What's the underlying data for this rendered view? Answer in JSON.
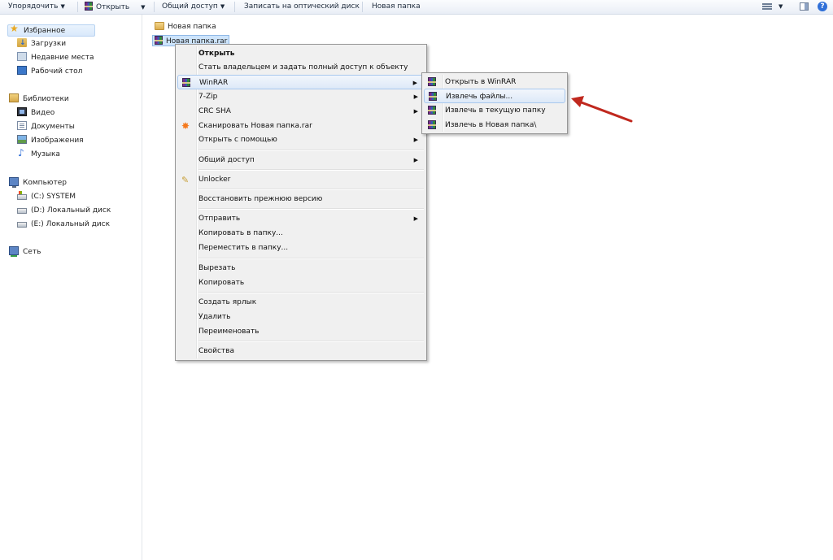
{
  "toolbar": {
    "organize": "Упорядочить",
    "open": "Открыть",
    "share": "Общий доступ",
    "burn": "Записать на оптический диск",
    "new_folder": "Новая папка",
    "help": "?"
  },
  "nav": {
    "favorites": "Избранное",
    "downloads": "Загрузки",
    "recent": "Недавние места",
    "desktop": "Рабочий стол",
    "libraries": "Библиотеки",
    "video": "Видео",
    "documents": "Документы",
    "pictures": "Изображения",
    "music": "Музыка",
    "computer": "Компьютер",
    "drive_c": "(C:) SYSTEM",
    "drive_d": "(D:) Локальный диск",
    "drive_e": "(E:) Локальный диск",
    "network": "Сеть"
  },
  "files": {
    "folder": "Новая папка",
    "archive": "Новая папка.rar"
  },
  "context_menu": {
    "open": "Открыть",
    "take_ownership": "Стать владельцем и задать полный доступ к объекту",
    "winrar": "WinRAR",
    "sevenzip": "7-Zip",
    "crc_sha": "CRC SHA",
    "scan": "Сканировать Новая папка.rar",
    "open_with": "Открыть с помощью",
    "share": "Общий доступ",
    "unlocker": "Unlocker",
    "restore": "Восстановить прежнюю версию",
    "send_to": "Отправить",
    "copy_to": "Копировать в папку...",
    "move_to": "Переместить в папку...",
    "cut": "Вырезать",
    "copy": "Копировать",
    "create_shortcut": "Создать ярлык",
    "delete": "Удалить",
    "rename": "Переименовать",
    "properties": "Свойства"
  },
  "winrar_submenu": {
    "open_in_winrar": "Открыть в WinRAR",
    "extract_files": "Извлечь файлы...",
    "extract_here": "Извлечь в текущую папку",
    "extract_to_folder": "Извлечь в Новая папка\\"
  },
  "colors": {
    "annotation_arrow": "#c0281e",
    "menu_highlight": "#dde9f8",
    "selection": "#cde4fb"
  }
}
